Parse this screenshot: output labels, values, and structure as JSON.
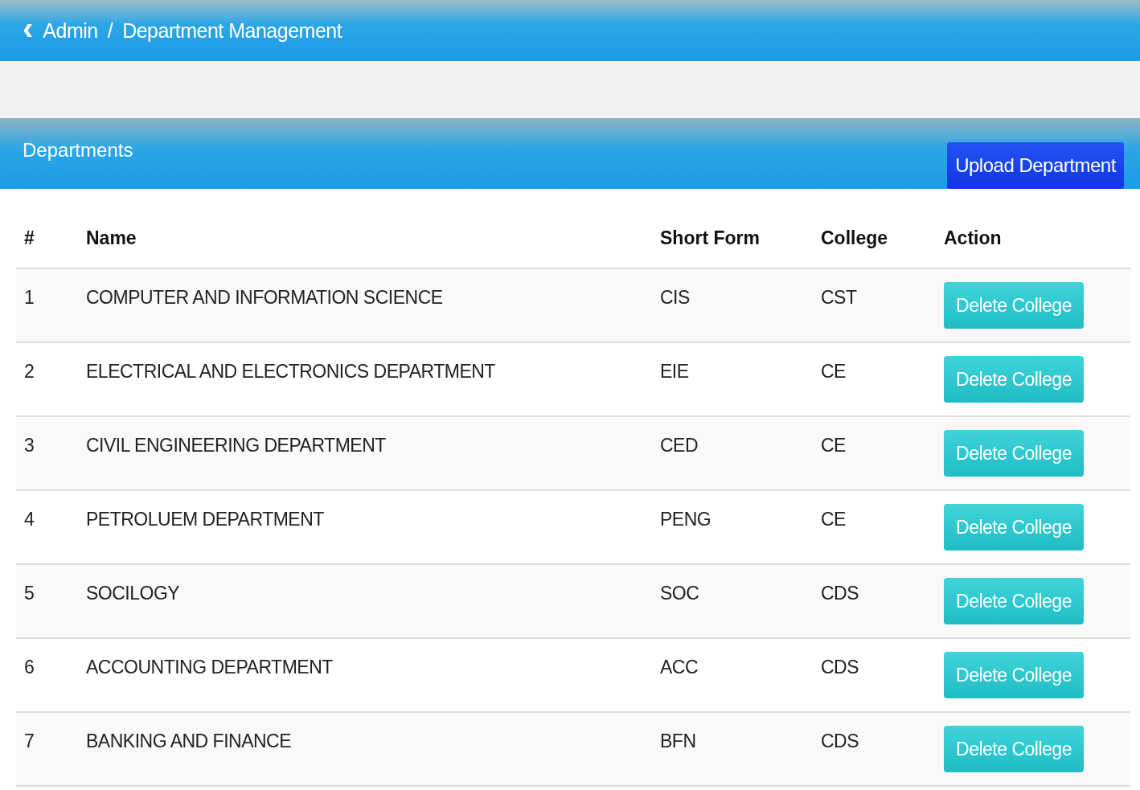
{
  "breadcrumb": {
    "back": "‹",
    "items": [
      "Admin",
      "Department Management"
    ],
    "separator": "/"
  },
  "panel": {
    "title": "Departments",
    "upload_button": "Upload Department"
  },
  "table": {
    "columns": [
      "#",
      "Name",
      "Short Form",
      "College",
      "Action"
    ],
    "rows": [
      {
        "number": "1",
        "name": "COMPUTER AND INFORMATION SCIENCE",
        "short_form": "CIS",
        "college": "CST",
        "action": "Delete College"
      },
      {
        "number": "2",
        "name": "ELECTRICAL AND ELECTRONICS DEPARTMENT",
        "short_form": "EIE",
        "college": "CE",
        "action": "Delete College"
      },
      {
        "number": "3",
        "name": "CIVIL ENGINEERING DEPARTMENT",
        "short_form": "CED",
        "college": "CE",
        "action": "Delete College"
      },
      {
        "number": "4",
        "name": "PETROLUEM DEPARTMENT",
        "short_form": "PENG",
        "college": "CE",
        "action": "Delete College"
      },
      {
        "number": "5",
        "name": "SOCILOGY",
        "short_form": "SOC",
        "college": "CDS",
        "action": "Delete College"
      },
      {
        "number": "6",
        "name": "ACCOUNTING DEPARTMENT",
        "short_form": "ACC",
        "college": "CDS",
        "action": "Delete College"
      },
      {
        "number": "7",
        "name": "BANKING AND FINANCE",
        "short_form": "BFN",
        "college": "CDS",
        "action": "Delete College"
      }
    ]
  }
}
